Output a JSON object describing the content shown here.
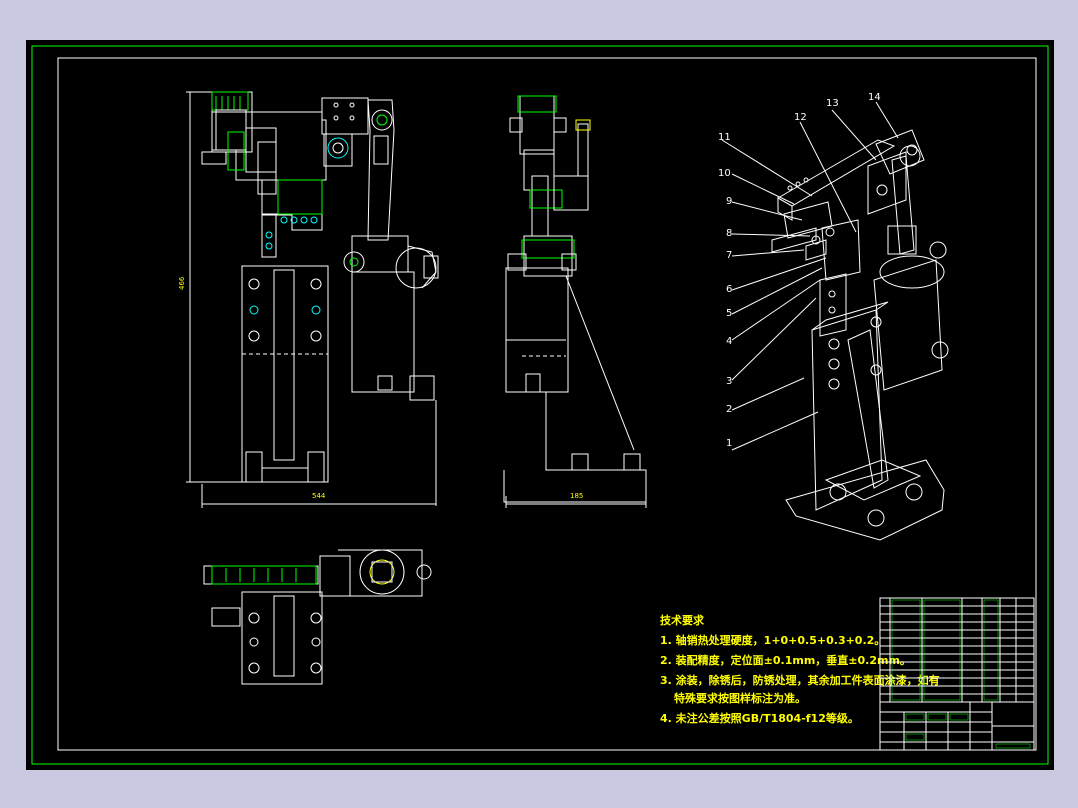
{
  "dims": {
    "front_height": "466",
    "front_width": "544",
    "side_width": "185"
  },
  "balloons": [
    "1",
    "2",
    "3",
    "4",
    "5",
    "6",
    "7",
    "8",
    "9",
    "10",
    "11",
    "12",
    "13",
    "14"
  ],
  "tech_notes": {
    "title": "技术要求",
    "lines": [
      "1. 轴销热处理硬度，1+0+0.5+0.3+0.2。",
      "2. 装配精度，定位面±0.1mm，垂直±0.2mm。",
      "3. 涂装，除锈后，防锈处理，其余加工件表面涂漆，如有",
      "特殊要求按图样标注为准。",
      "4. 未注公差按照GB/T1804-f12等级。"
    ]
  },
  "colors": {
    "frame": "#ffffff",
    "green": "#00ff00",
    "cyan": "#00ffff",
    "yellow": "#ffff00",
    "outer_bg": "#c8c8e0",
    "sheet_bg": "#000000"
  }
}
